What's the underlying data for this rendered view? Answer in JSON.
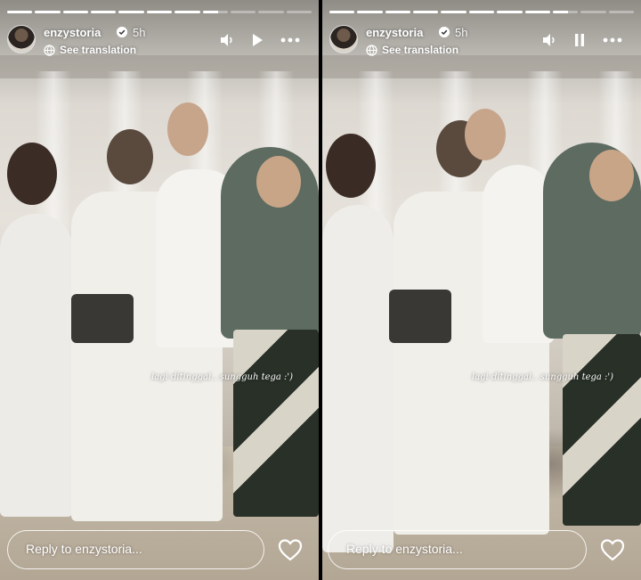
{
  "stories": [
    {
      "id": "left",
      "progress": {
        "segments_total": 11,
        "segments_done": 7,
        "current_fraction": 0.6
      },
      "header": {
        "username": "enzystoria",
        "time": "5h",
        "translate_label": "See translation",
        "playback_state": "paused"
      },
      "caption": "lagi ditinggal.. sungguh tega :')",
      "reply_placeholder": "Reply to enzystoria...",
      "icons": [
        "speaker-icon",
        "play-icon",
        "more-icon",
        "heart-icon",
        "verified-badge-icon",
        "translate-icon"
      ]
    },
    {
      "id": "right",
      "progress": {
        "segments_total": 11,
        "segments_done": 8,
        "current_fraction": 0.5
      },
      "header": {
        "username": "enzystoria",
        "time": "5h",
        "translate_label": "See translation",
        "playback_state": "playing"
      },
      "caption": "lagi ditinggal.. sungguh tega :')",
      "reply_placeholder": "Reply to enzystoria...",
      "icons": [
        "speaker-icon",
        "pause-icon",
        "more-icon",
        "heart-icon",
        "verified-badge-icon",
        "translate-icon"
      ]
    }
  ],
  "colors": {
    "text": "#ffffff",
    "progress_done": "#ffffff",
    "progress_pending": "rgba(255,255,255,0.35)",
    "verified": "#ffffff"
  }
}
